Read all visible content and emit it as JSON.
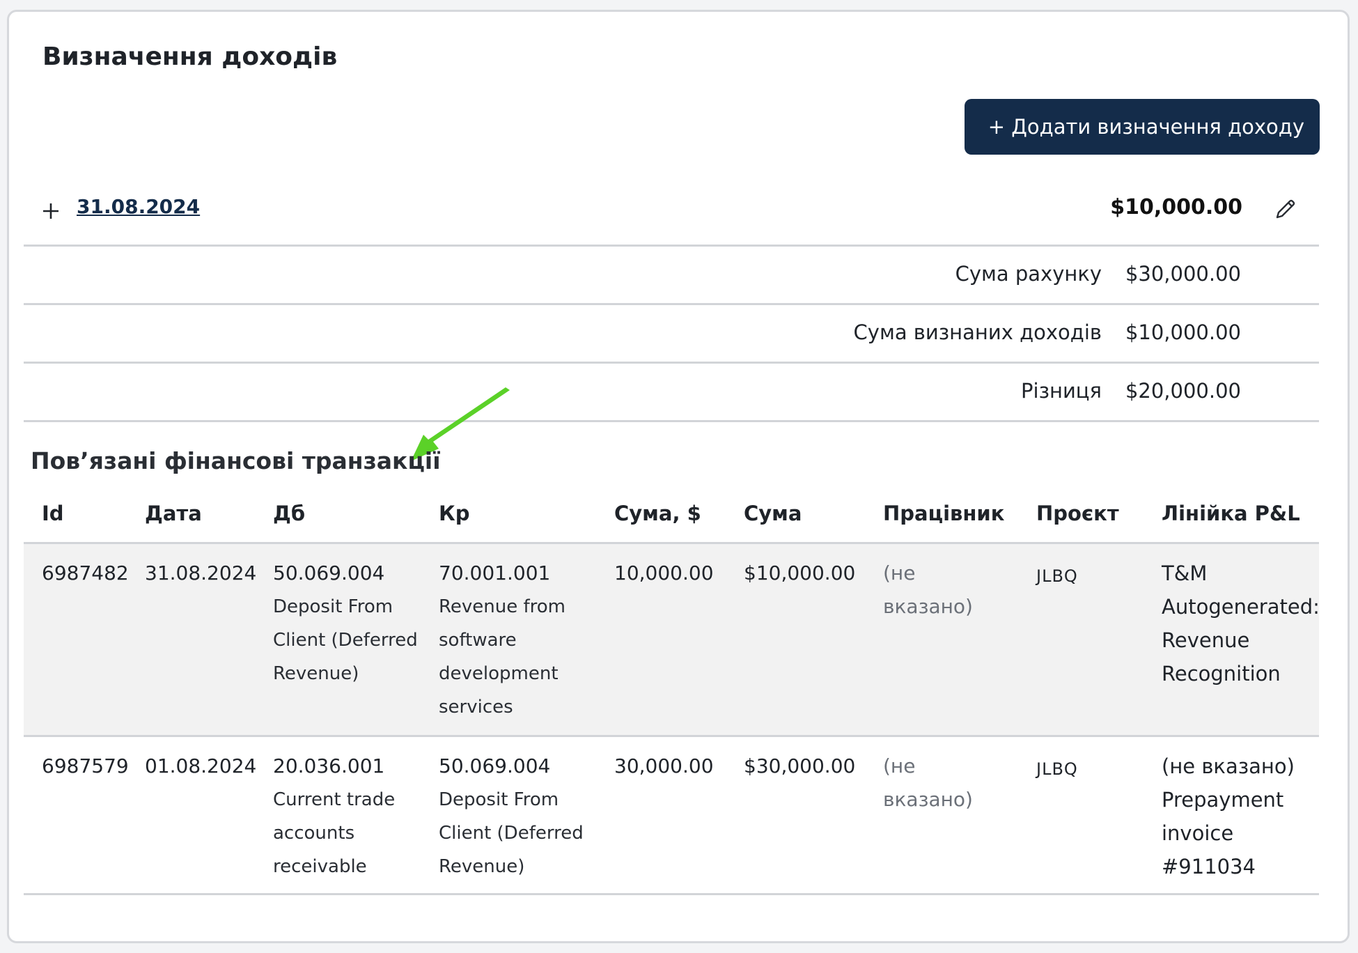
{
  "page": {
    "title": "Визначення доходів",
    "add_button": "+ Додати визначення доходу",
    "add_button_icon": "plus-icon"
  },
  "recognition": {
    "expand_icon": "plus",
    "date": "31.08.2024",
    "amount": "$10,000.00",
    "edit_icon": "pencil-icon"
  },
  "summary": [
    {
      "label": "Сума рахунку",
      "value": "$30,000.00"
    },
    {
      "label": "Сума визнаних доходів",
      "value": "$10,000.00"
    },
    {
      "label": "Різниця",
      "value": "$20,000.00"
    }
  ],
  "annotation": {
    "icon": "green-arrow-icon",
    "color": "#5bd128"
  },
  "transactions": {
    "title": "Пов’язані фінансові транзакції",
    "columns": [
      "Id",
      "Дата",
      "Дб",
      "Кр",
      "Сума, $",
      "Сума",
      "Працівник",
      "Проєкт",
      "Лінійка P&L"
    ],
    "rows": [
      {
        "id": "6987482",
        "date": "31.08.2024",
        "debit_code": "50.069.004",
        "debit_name": "Deposit From Client (Deferred Revenue)",
        "credit_code": "70.001.001",
        "credit_name": "Revenue from software development services",
        "amount_usd": "10,000.00",
        "amount": "$10,000.00",
        "employee": "(не вказано)",
        "project": "JLBQ",
        "pl_line": "",
        "pl_note": "T&M Autogenerated: Revenue Recognition"
      },
      {
        "id": "6987579",
        "date": "01.08.2024",
        "debit_code": "20.036.001",
        "debit_name": "Current trade accounts receivable",
        "credit_code": "50.069.004",
        "credit_name": "Deposit From Client (Deferred Revenue)",
        "amount_usd": "30,000.00",
        "amount": "$30,000.00",
        "employee": "(не вказано)",
        "project": "JLBQ",
        "pl_line": "(не вказано)",
        "pl_note": "Prepayment invoice #911034"
      }
    ]
  },
  "colors": {
    "button_bg": "#142c4a",
    "row_shade": "#f2f2f2",
    "divider": "#d2d4d8",
    "muted_text": "#6b7078"
  }
}
